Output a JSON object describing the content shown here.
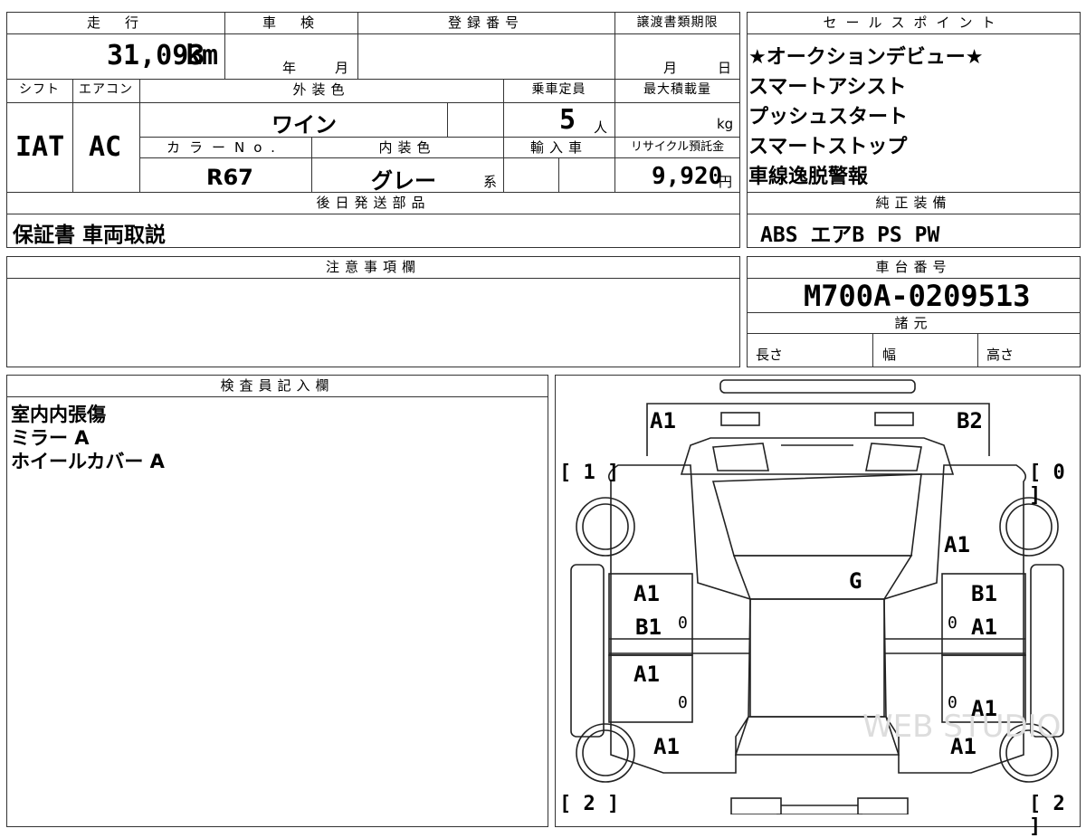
{
  "header": {
    "mileage_label": "走　行",
    "mileage_value": "31,093",
    "mileage_unit": "km",
    "shaken_label": "車　検",
    "shaken_year": "年",
    "shaken_month": "月",
    "registration_label": "登録番号",
    "transfer_label": "譲渡書類期限",
    "transfer_month": "月",
    "transfer_day": "日"
  },
  "specs": {
    "shift_label": "シフト",
    "ac_label": "エアコン",
    "exterior_label": "外装色",
    "capacity_label": "乗車定員",
    "maxload_label": "最大積載量",
    "shift_value": "IAT",
    "ac_value": "AC",
    "exterior_value": "ワイン",
    "capacity_value": "5",
    "capacity_unit": "人",
    "maxload_unit": "kg",
    "color_no_label": "カラーNo.",
    "interior_label": "内装色",
    "import_label": "輸入車",
    "recycle_label": "リサイクル預託金",
    "color_no_value": "R67",
    "interior_value": "グレー",
    "interior_suffix": "系",
    "recycle_value": "9,920",
    "recycle_unit": "円"
  },
  "later_parts": {
    "label": "後日発送部品",
    "value": "保証書 車両取説"
  },
  "notes": {
    "label": "注意事項欄"
  },
  "sales_points": {
    "label": "セールスポイント",
    "items": [
      "★オークションデビュー★",
      "スマートアシスト",
      "プッシュスタート",
      "スマートストップ",
      "車線逸脱警報"
    ]
  },
  "equipment": {
    "label": "純正装備",
    "value": "ABS エアB PS PW"
  },
  "chassis": {
    "label": "車台番号",
    "value": "M700A-0209513"
  },
  "dimensions": {
    "label": "諸元",
    "length": "長さ",
    "width": "幅",
    "height": "高さ"
  },
  "inspector": {
    "label": "検査員記入欄",
    "lines": [
      "室内内張傷",
      "ミラー A",
      "ホイールカバー A"
    ]
  },
  "diagram": {
    "corner_tl": "[ 1 ]",
    "corner_tr": "[ 0 ]",
    "corner_bl": "[ 2 ]",
    "corner_br": "[ 2 ]",
    "marks": {
      "front_left": "A1",
      "front_right": "B2",
      "right_fender": "A1",
      "roof": "G",
      "left_front_door_1": "A1",
      "left_front_door_2": "B1",
      "right_front_door_1": "B1",
      "right_front_door_2": "A1",
      "left_rear_door": "A1",
      "right_rear_door": "A1",
      "left_rear_fender": "A1",
      "right_rear_fender": "A1"
    },
    "zero": "0",
    "watermark": "WEB STUDIO"
  }
}
